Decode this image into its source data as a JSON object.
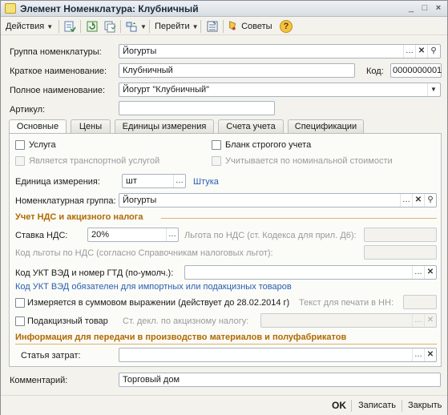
{
  "window": {
    "title": "Элемент Номенклатура: Клубничный",
    "controls": {
      "minimize": "_",
      "maximize": "□",
      "close": "×"
    }
  },
  "toolbar": {
    "actions_label": "Действия",
    "goto_label": "Перейти",
    "advice_label": "Советы",
    "help_label": "?"
  },
  "header_fields": {
    "group": {
      "label": "Группа номенклатуры:",
      "value": "Йогурты"
    },
    "short_name": {
      "label": "Краткое наименование:",
      "value": "Клубничный"
    },
    "code": {
      "label": "Код:",
      "value": "0000000001"
    },
    "full_name": {
      "label": "Полное наименование:",
      "value": "Йогурт \"Клубничный\""
    },
    "article": {
      "label": "Артикул:",
      "value": ""
    }
  },
  "tabs": [
    {
      "label": "Основные",
      "active": true
    },
    {
      "label": "Цены",
      "active": false
    },
    {
      "label": "Единицы измерения",
      "active": false
    },
    {
      "label": "Счета учета",
      "active": false
    },
    {
      "label": "Спецификации",
      "active": false
    }
  ],
  "main": {
    "service_checkbox": {
      "label": "Услуга",
      "checked": false
    },
    "transport_checkbox": {
      "label": "Является транспортной услугой",
      "checked": false
    },
    "strict_form_checkbox": {
      "label": "Бланк строгого учета",
      "checked": false
    },
    "nominal_cost_checkbox": {
      "label": "Учитывается по номинальной стоимости",
      "checked": false
    },
    "unit": {
      "label": "Единица измерения:",
      "value": "шт",
      "link": "Штука"
    },
    "nomenclature_group": {
      "label": "Номенклатурная группа:",
      "value": "Йогурты"
    },
    "vat_section_title": "Учет НДС и акцизного налога",
    "vat_rate": {
      "label": "Ставка НДС:",
      "value": "20%"
    },
    "vat_benefit": {
      "label": "Льгота по НДС (ст. Кодекса для прил. Д6):",
      "value": ""
    },
    "vat_benefit_code": {
      "label": "Код льготы по НДС (согласно Справочникам налоговых льгот):",
      "value": ""
    },
    "ukt_code": {
      "label": "Код УКТ ВЭД и номер ГТД (по-умолч.):",
      "value": ""
    },
    "ukt_note": "Код УКТ ВЭД обязателен для импортных или подакцизных товаров",
    "sum_measure_checkbox": {
      "label": "Измеряется в суммовом выражении (действует до 28.02.2014 г)",
      "checked": false
    },
    "print_text": {
      "label": "Текст для печати в НН:",
      "value": ""
    },
    "excise_checkbox": {
      "label": "Подакцизный товар",
      "checked": false
    },
    "excise_article": {
      "label": "Ст. декл. по акцизному налогу:",
      "value": ""
    },
    "production_section_title": "Информация для передачи в производство материалов и полуфабрикатов",
    "cost_item": {
      "label": "Статья затрат:",
      "value": ""
    }
  },
  "comment": {
    "label": "Комментарий:",
    "value": "Торговый дом"
  },
  "bottom": {
    "ok_label": "OK",
    "save_label": "Записать",
    "close_label": "Закрыть"
  },
  "colors": {
    "section_title": "#b06a00",
    "link": "#2a5fb0",
    "window_bg": "#f3f2ec"
  }
}
